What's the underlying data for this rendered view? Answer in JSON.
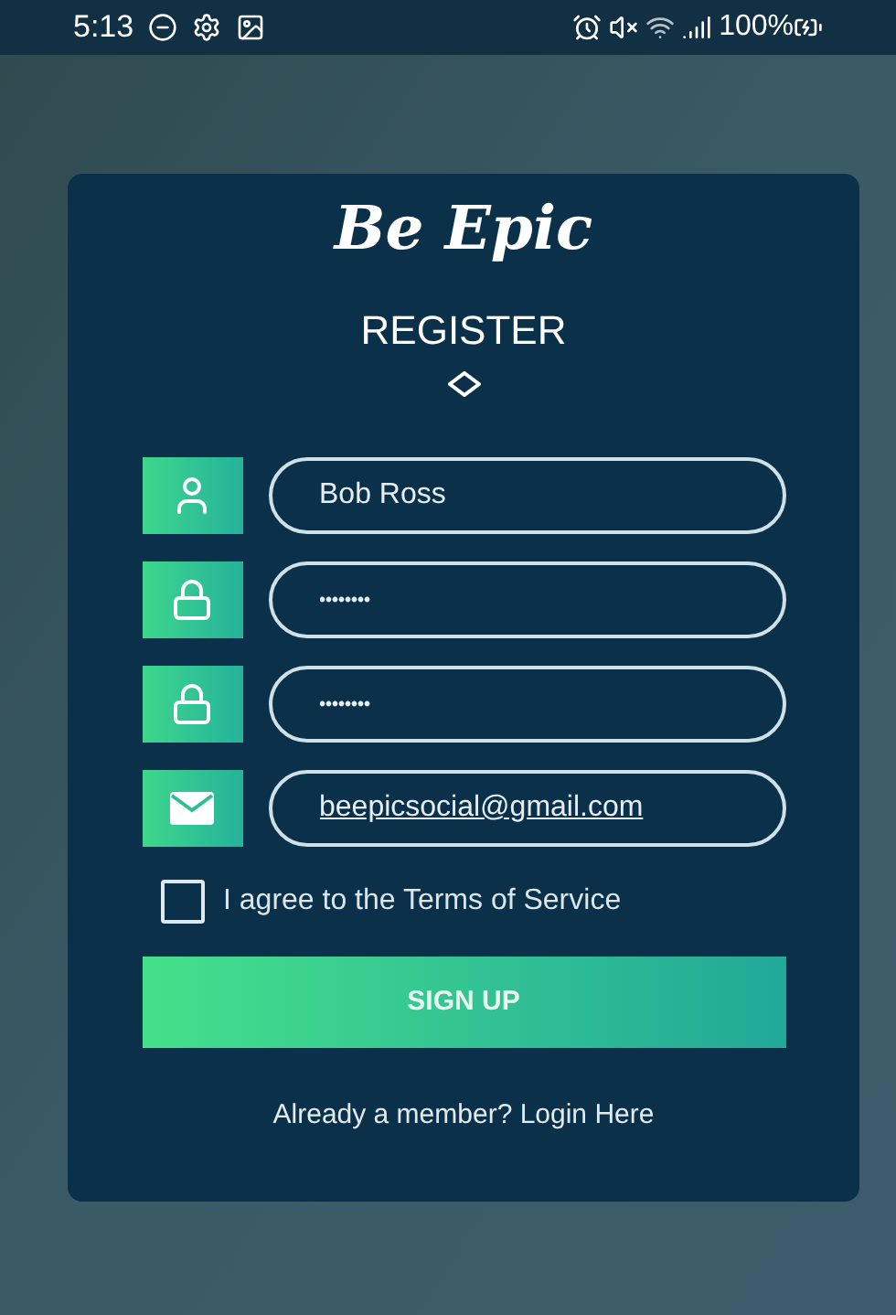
{
  "status_bar": {
    "time": "5:13",
    "battery": "100%"
  },
  "card": {
    "logo": "Be Epic",
    "title": "REGISTER"
  },
  "fields": [
    {
      "kind": "user",
      "value": "Bob Ross"
    },
    {
      "kind": "password",
      "value": "••••••••"
    },
    {
      "kind": "password",
      "value": "••••••••"
    },
    {
      "kind": "email",
      "value": "beepicsocial@gmail.com"
    }
  ],
  "terms": {
    "label": "I agree to the Terms of Service",
    "checked": false
  },
  "submit": {
    "label": "SIGN UP"
  },
  "login_link": {
    "label": "Already a member? Login Here"
  }
}
